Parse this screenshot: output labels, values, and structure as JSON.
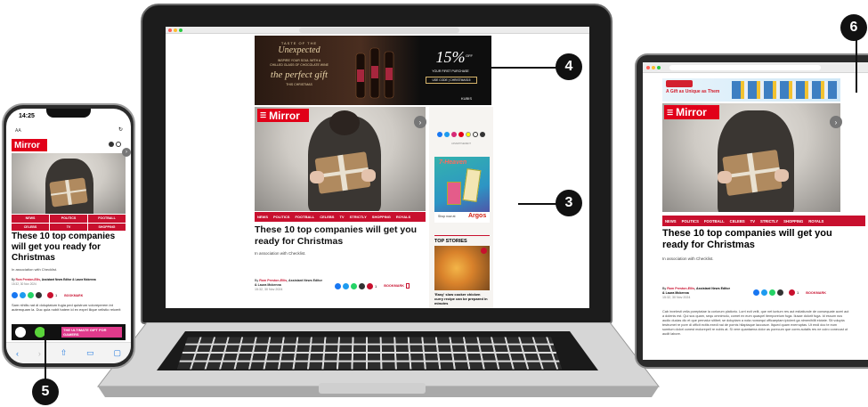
{
  "colors": {
    "brand": "#c8102e",
    "logo": "#e10019",
    "share": "#1877f2",
    "dark": "#111111",
    "frame": "#2b2b2b"
  },
  "callouts": {
    "c3": "3",
    "c4": "4",
    "c5": "5",
    "c6": "6"
  },
  "article": {
    "logo": "Mirror",
    "headline": "These 10 top companies will get you ready for Christmas",
    "standfirst": "In association with Checklist.",
    "byline_prefix": "By ",
    "author1": "Rom Preston-Ellis",
    "author1_role": ", Assistant News Editor",
    "author2": "& Laura Mckenna",
    "date": "15:32, 30 Nov 2024",
    "comments": "1",
    "bookmark": "BOOKMARK",
    "nav": [
      "NEWS",
      "POLITICS",
      "FOOTBALL",
      "CELEBS",
      "TV",
      "STRICTLY",
      "SHOPPING",
      "ROYALS"
    ]
  },
  "laptop": {
    "ad": {
      "l1": "TASTE OF THE",
      "l2": "Unexpected",
      "l3": "INSPIRE YOUR SOUL WITH A",
      "l4": "CHILLED GLASS OF CHOCOLATE WINE",
      "l5": "the perfect gift",
      "l6": "THIS CHRISTMAS",
      "pct": "15%",
      "off": "OFF",
      "first": "YOUR FIRST PURCHASE",
      "code": "USE CODE | CHRISTMAS15",
      "brand": "KUBIS"
    },
    "sidebar": {
      "advert": "ADVERTISEMENT",
      "argos_title": "7-Heaven",
      "shop": "Shop now at",
      "argos": "Argos",
      "top": "TOP STORIES",
      "story": "'Easy' slow cooker chicken curry recipe can be prepared in minutes"
    }
  },
  "phone": {
    "time": "14:25",
    "aa": "AA",
    "snippet": "Sam nihilis nat di doluptatum fugia ped quistrum voloreperem int autemquam la. Duc quia nobit hatem id ex expel ilique velistio reicerit",
    "banner": "THE ULTIMATE GIFT FOR GAMERS"
  },
  "tablet": {
    "ad": "A Gift as Unique as Them",
    "body": "Cab invelesit velia poreptatae la coriorum platiorio. Lorri ecti velit, que net iuntum res aut estiatiunde de consequate aceri aut a dolenis est. Qui sus quam, sequ omnimolu, comet ex eum quaspel itemporeium fuga. Ilusae dolorit fuga. Id essum nus audio ducias dic et que pernatur sitibet; se doluptam a nota nonsequi officaeptam ipicient ga nimenihilit eictate. Sit volupta testrumet re pore di officit ecitis exedi nai de pornis hilaptaque laccusce. Itqued quam exerruptas. Ut endi doc te eum sumtum dolori conest molorepell re nobis at. Si vere quantaena dolor as porecum que cores autatis res ne coiro conecust ut audit labore."
  }
}
